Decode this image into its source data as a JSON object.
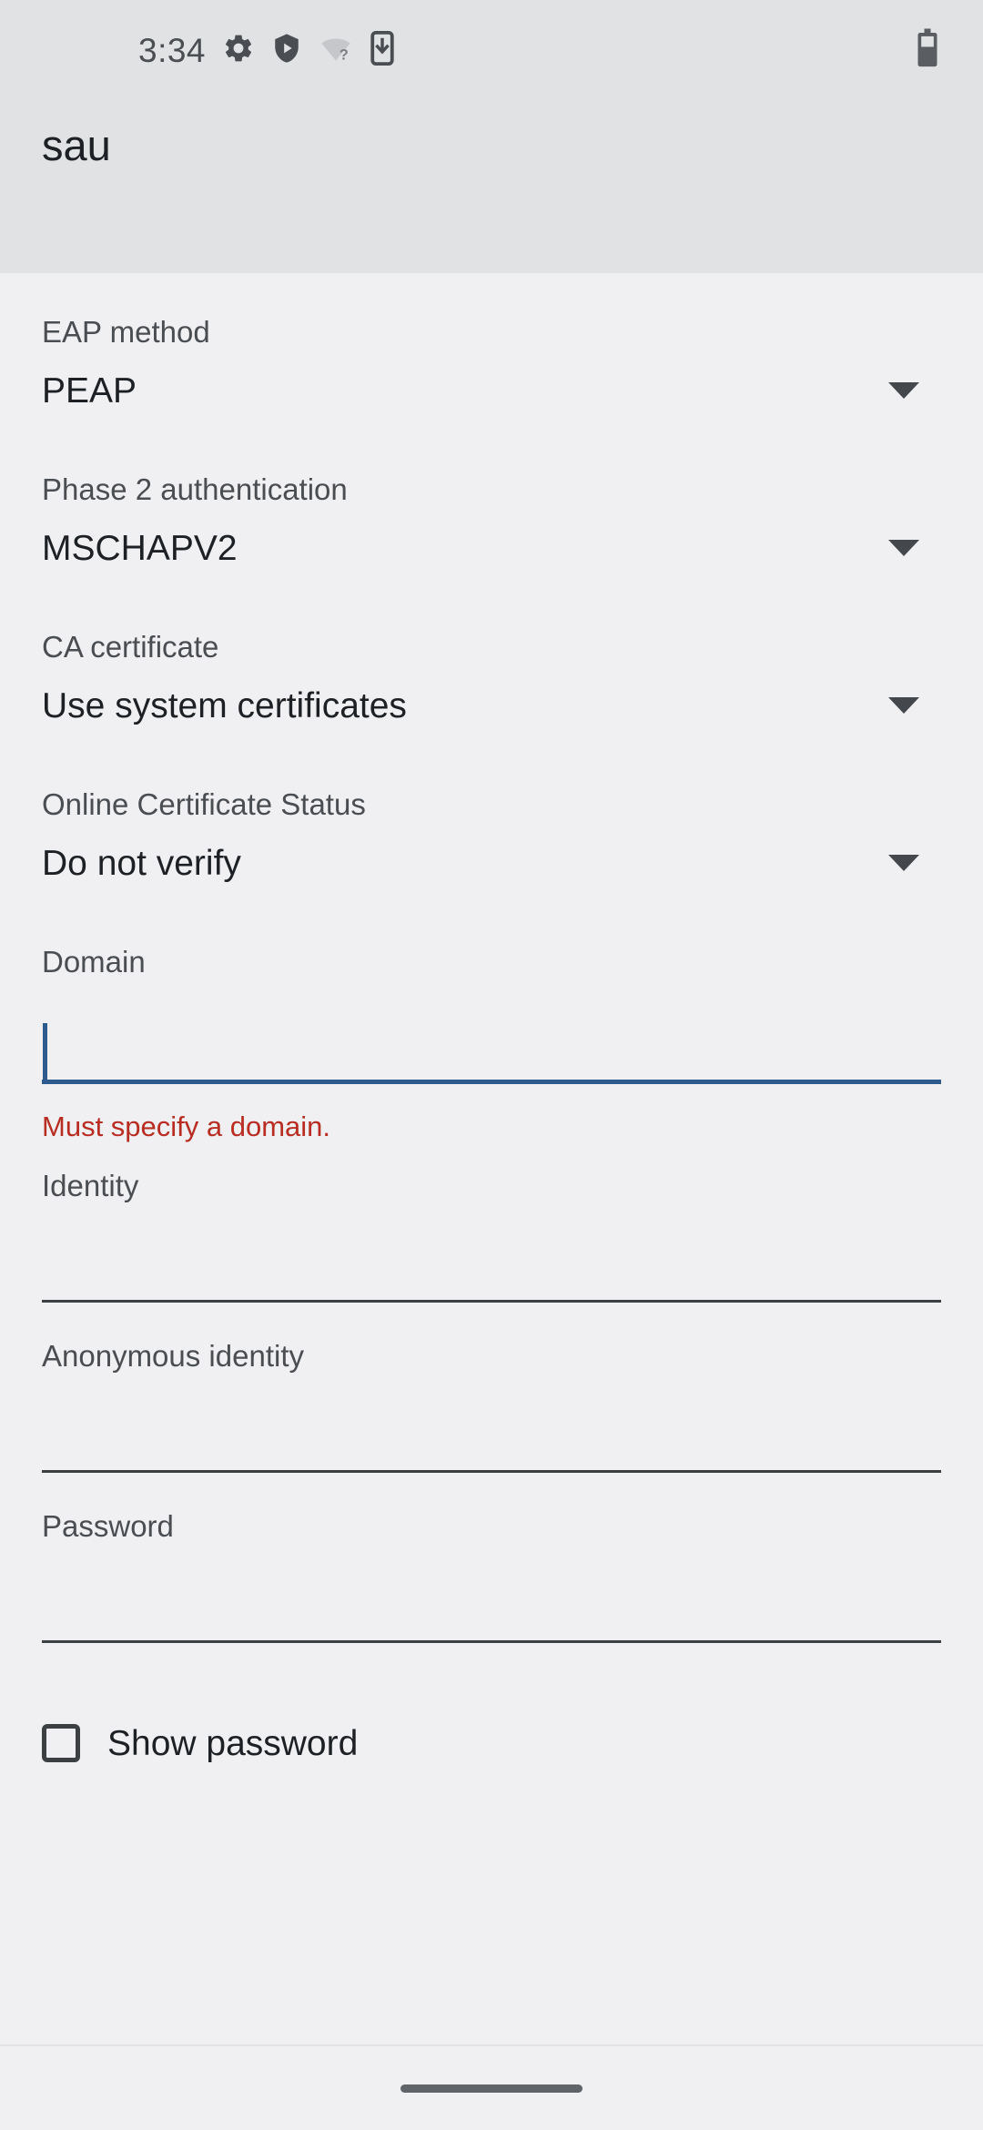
{
  "status_bar": {
    "clock": "3:34",
    "icons": [
      {
        "name": "settings-gear-icon"
      },
      {
        "name": "play-protect-shield-icon"
      },
      {
        "name": "wifi-unknown-icon"
      },
      {
        "name": "phone-download-icon"
      }
    ],
    "battery": {
      "name": "battery-icon",
      "level_pct": 70
    }
  },
  "header": {
    "title": "sau"
  },
  "form": {
    "eap_method": {
      "label": "EAP method",
      "value": "PEAP"
    },
    "phase2": {
      "label": "Phase 2 authentication",
      "value": "MSCHAPV2"
    },
    "ca_certificate": {
      "label": "CA certificate",
      "value": "Use system certificates"
    },
    "ocsp": {
      "label": "Online Certificate Status",
      "value": "Do not verify"
    },
    "domain": {
      "label": "Domain",
      "value": "",
      "error": "Must specify a domain."
    },
    "identity": {
      "label": "Identity",
      "value": ""
    },
    "anonymous_identity": {
      "label": "Anonymous identity",
      "value": ""
    },
    "password": {
      "label": "Password",
      "value": ""
    },
    "show_password": {
      "label": "Show password",
      "checked": false
    }
  },
  "navigation_bar": {
    "gesture_pill": "home-gesture-pill"
  },
  "colors": {
    "accent_blue": "#2d5b8e",
    "error_red": "#b82c21",
    "header_bg": "#e1e2e4",
    "body_bg": "#f0f0f2",
    "text_primary": "#1d2024",
    "text_secondary": "#4a4d52"
  }
}
